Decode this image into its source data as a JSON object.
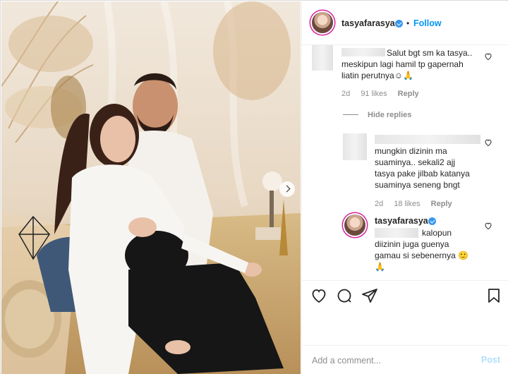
{
  "post": {
    "username": "tasyafarasya",
    "follow_label": "Follow",
    "separator": "•",
    "more_label": "•••"
  },
  "comments": [
    {
      "text": "Salut bgt sm ka tasya..\nmeskipun lagi hamil tp gapernah\nliatin perutnya☺🙏",
      "age": "2d",
      "likes": "91 likes",
      "reply_label": "Reply"
    }
  ],
  "hide_replies_label": "Hide replies",
  "replies": [
    {
      "text": "mungkin dizinin ma\nsuaminya.. sekali2 ajj\ntasya pake jilbab katanya\nsuaminya seneng bngt",
      "age": "2d",
      "likes": "18 likes",
      "reply_label": "Reply"
    },
    {
      "username": "tasyafarasya",
      "text_line1": "kalopun",
      "text_rest": "diizinin juga guenya\ngamau si sebenernya 🙂\n🙏"
    }
  ],
  "add_comment": {
    "placeholder": "Add a comment...",
    "post_label": "Post"
  },
  "icons": {
    "like": "heart-icon",
    "comment": "comment-icon",
    "share": "paper-plane-icon",
    "save": "bookmark-icon",
    "next": "chevron-right-icon",
    "verified": "verified-badge-icon"
  },
  "colors": {
    "accent": "#0095f6",
    "verified": "#3897f0",
    "muted": "#8e8e8e",
    "post_disabled": "#b2dffc"
  }
}
